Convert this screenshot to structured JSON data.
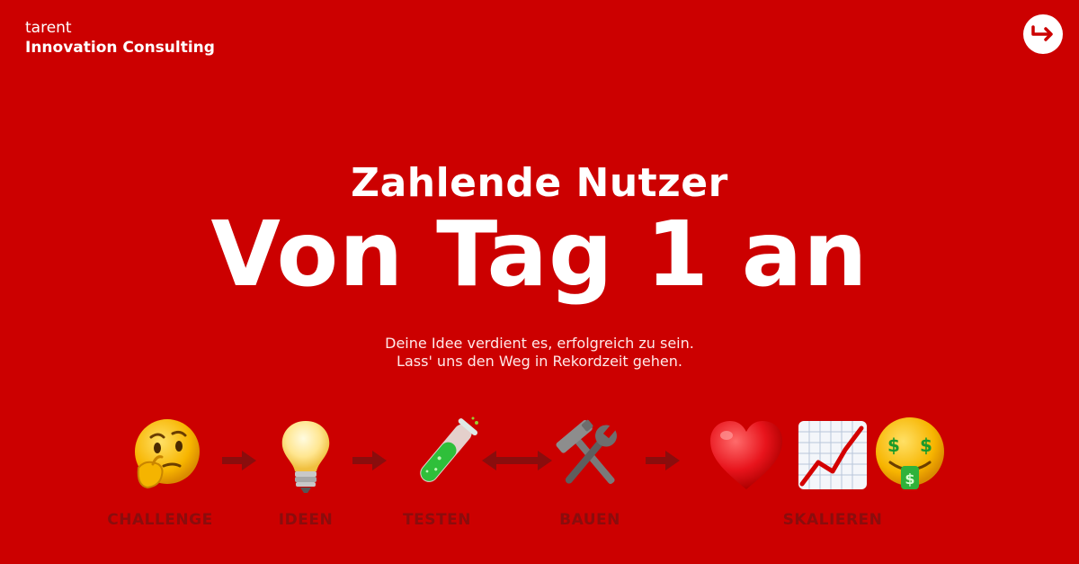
{
  "brand": {
    "company": "tarent",
    "unit": "Innovation Consulting"
  },
  "header": {
    "exit_icon": "arrow-right-turn-icon"
  },
  "hero": {
    "title": "Zahlende Nutzer",
    "headline": "Von Tag 1 an",
    "subtitle_line1": "Deine Idee verdient es, erfolgreich zu sein.",
    "subtitle_line2": "Lass' uns den Weg in Rekordzeit gehen."
  },
  "steps": [
    {
      "icon": "thinking-face-icon",
      "label": "CHALLENGE"
    },
    {
      "icon": "light-bulb-icon",
      "label": "IDEEN"
    },
    {
      "icon": "test-tube-icon",
      "label": "TESTEN"
    },
    {
      "icon": "hammer-and-wrench-icon",
      "label": "BAUEN"
    },
    {
      "icon": "heart-chart-money-face-icons",
      "label": "SKALIEREN"
    }
  ],
  "colors": {
    "background": "#cc0000",
    "label": "#8a0d0d",
    "arrow": "#8a0d0d"
  }
}
